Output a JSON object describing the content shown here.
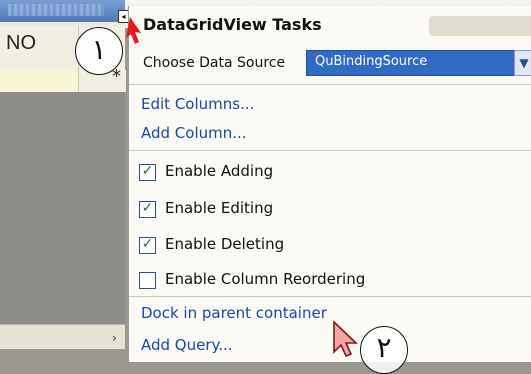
{
  "grid": {
    "column_header": "NO",
    "new_row_marker": "*",
    "scroll_arrow": "›"
  },
  "smart_tag": {
    "glyph": "◂"
  },
  "panel": {
    "title": "DataGridView Tasks",
    "choose_data_source": {
      "label": "Choose Data Source",
      "value": "QuBindingSource",
      "caret": "▼"
    },
    "links_top": [
      "Edit Columns...",
      "Add Column..."
    ],
    "checkboxes": [
      {
        "label": "Enable Adding",
        "checked": true
      },
      {
        "label": "Enable Editing",
        "checked": true
      },
      {
        "label": "Enable Deleting",
        "checked": true
      },
      {
        "label": "Enable Column Reordering",
        "checked": false
      }
    ],
    "links_bottom": [
      "Dock in parent container",
      "Add Query..."
    ]
  },
  "callouts": {
    "one": "١",
    "two": "٢"
  },
  "colors": {
    "accent_red": "#e11b1b",
    "selection_blue": "#316ac5",
    "link_blue": "#1746b0"
  }
}
